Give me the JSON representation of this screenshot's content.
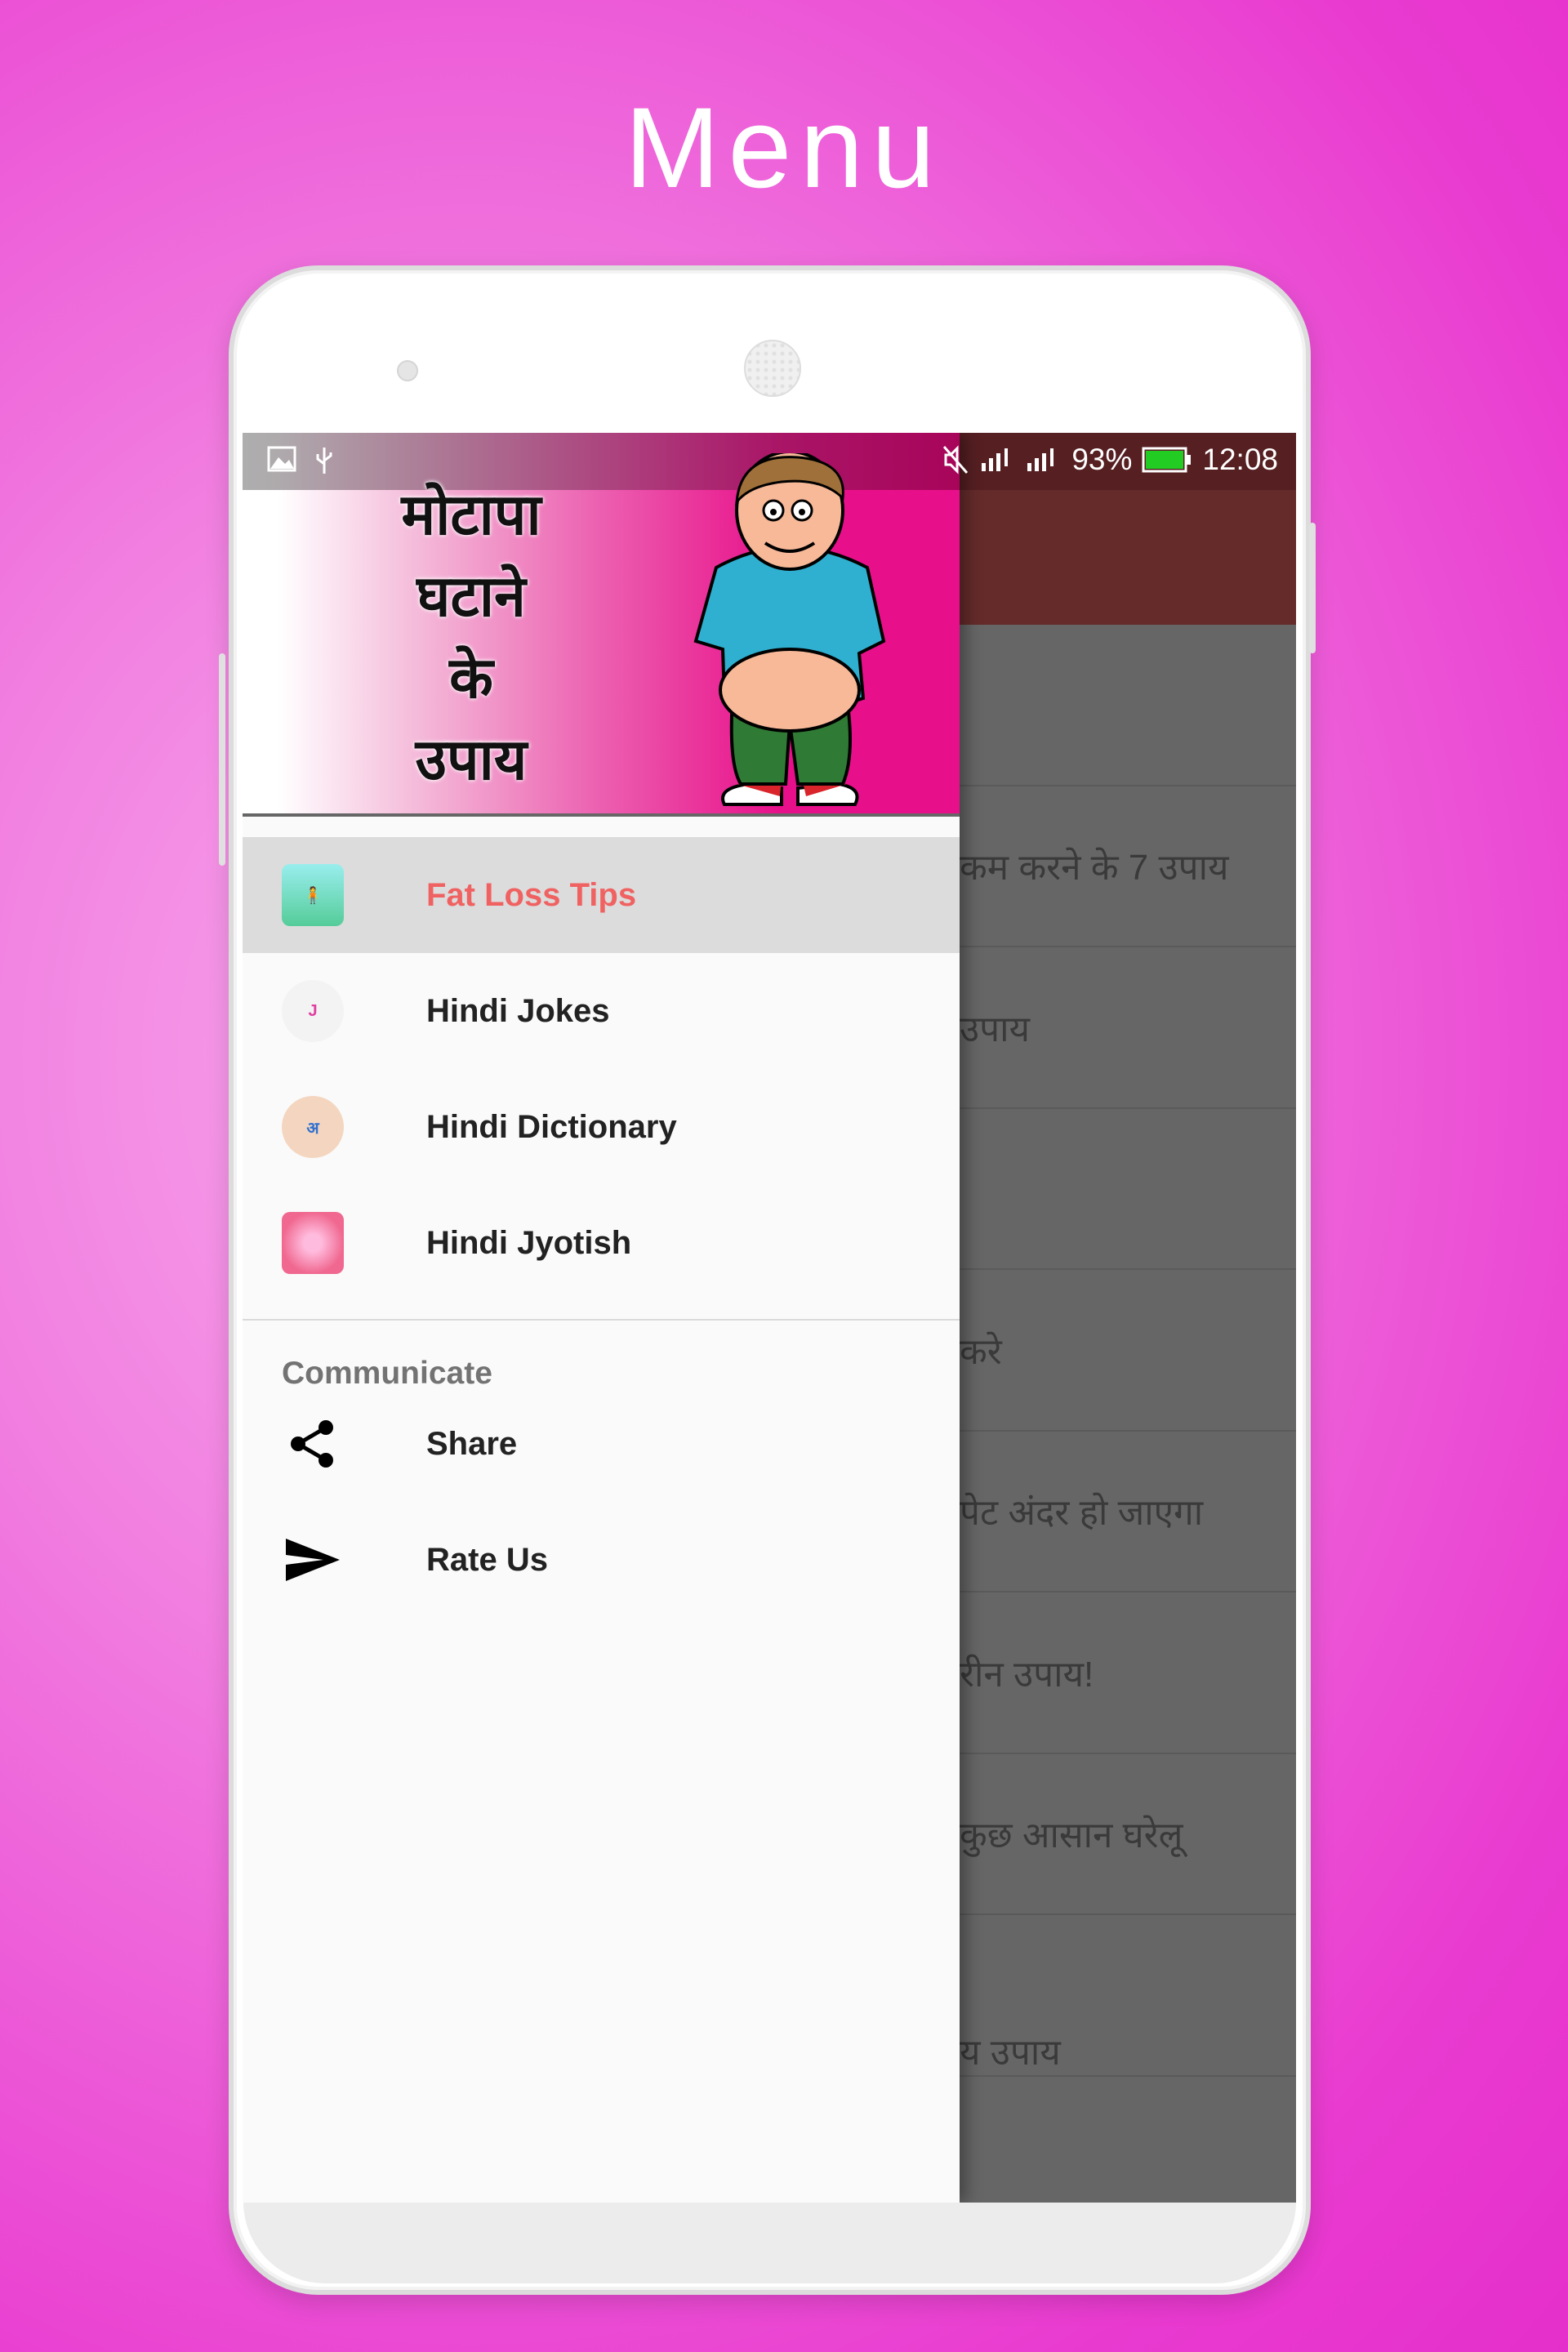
{
  "page_title": "Menu",
  "status_bar": {
    "battery": "93%",
    "time": "12:08",
    "icons": [
      "image-icon",
      "usb-icon",
      "mute-icon",
      "signal-icon",
      "signal-icon",
      "battery-icon"
    ],
    "battery_color": "#22cc22"
  },
  "drawer": {
    "header_text": [
      "मोटापा",
      "घटाने",
      "के",
      "उपाय"
    ],
    "items": [
      {
        "label": "Fat Loss Tips",
        "icon": "fat-loss-app-icon",
        "selected": true
      },
      {
        "label": "Hindi Jokes",
        "icon": "hindi-jokes-app-icon"
      },
      {
        "label": "Hindi Dictionary",
        "icon": "hindi-dictionary-app-icon"
      },
      {
        "label": "Hindi Jyotish",
        "icon": "hindi-jyotish-app-icon"
      }
    ],
    "section_title": "Communicate",
    "communicate": [
      {
        "label": "Share",
        "icon": "share-icon"
      },
      {
        "label": "Rate Us",
        "icon": "send-icon"
      }
    ]
  },
  "background_list": [
    "",
    "कम करने के 7 उपाय",
    "उपाय",
    "",
    "करे",
    "पेट अंदर हो जाएगा",
    "रीन उपाय!",
    "कुछ आसान घरेलू",
    "य उपाय"
  ],
  "colors": {
    "accent": "#f06262",
    "toolbar": "#652b2b",
    "header_pink": "#e8108a"
  }
}
